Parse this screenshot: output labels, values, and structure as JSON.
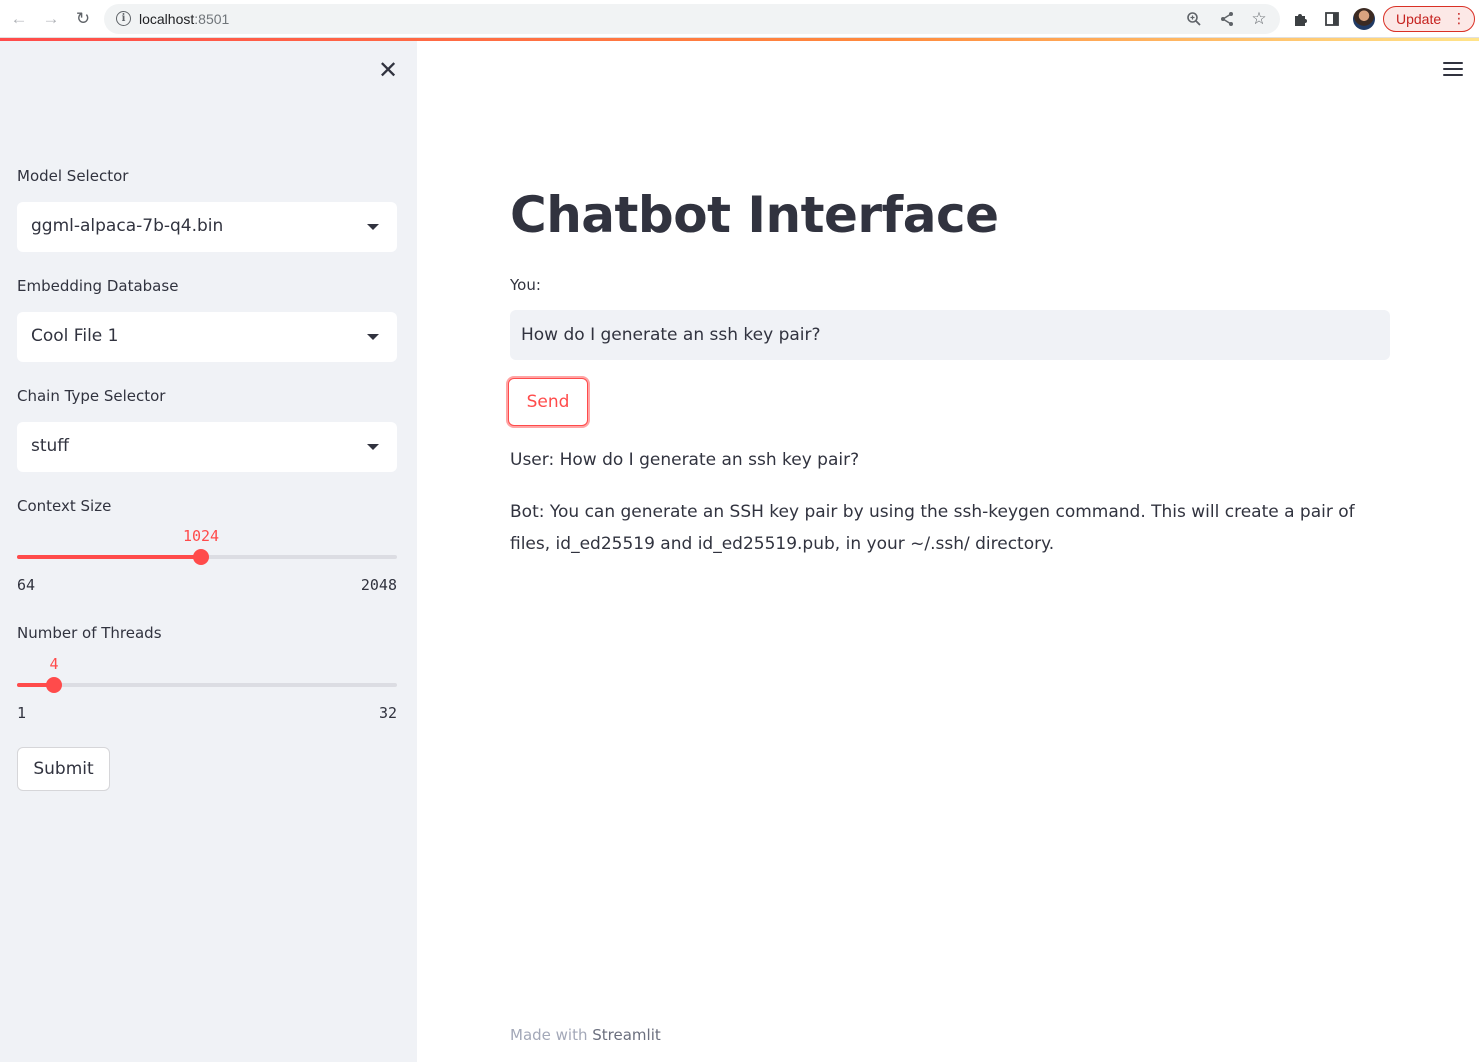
{
  "browser": {
    "url_host": "localhost",
    "url_port": ":8501",
    "update_label": "Update",
    "icons": [
      "back-arrow-icon",
      "forward-arrow-icon",
      "reload-icon",
      "info-icon",
      "zoom-icon",
      "share-icon",
      "star-icon",
      "extensions-icon",
      "side-panel-icon",
      "profile-avatar",
      "more-options-icon"
    ]
  },
  "sidebar": {
    "model_selector": {
      "label": "Model Selector",
      "value": "ggml-alpaca-7b-q4.bin"
    },
    "embedding_database": {
      "label": "Embedding Database",
      "value": "Cool File 1"
    },
    "chain_type_selector": {
      "label": "Chain Type Selector",
      "value": "stuff"
    },
    "context_size": {
      "label": "Context Size",
      "value": "1024",
      "min": "64",
      "max": "2048",
      "fraction": 0.4848
    },
    "number_of_threads": {
      "label": "Number of Threads",
      "value": "4",
      "min": "1",
      "max": "32",
      "fraction": 0.0968
    },
    "submit_label": "Submit"
  },
  "main": {
    "title": "Chatbot Interface",
    "input_label": "You:",
    "input_value": "How do I generate an ssh key pair?",
    "send_label": "Send",
    "messages": [
      "User: How do I generate an ssh key pair?",
      "Bot: You can generate an SSH key pair by using the ssh-keygen command. This will create a pair of files, id_ed25519 and id_ed25519.pub, in your ~/.ssh/ directory."
    ],
    "footer_prefix": "Made with ",
    "footer_link": "Streamlit"
  },
  "colors": {
    "accent": "#ff4b4b",
    "sidebar_bg": "#f0f2f6",
    "text": "#31333f"
  }
}
